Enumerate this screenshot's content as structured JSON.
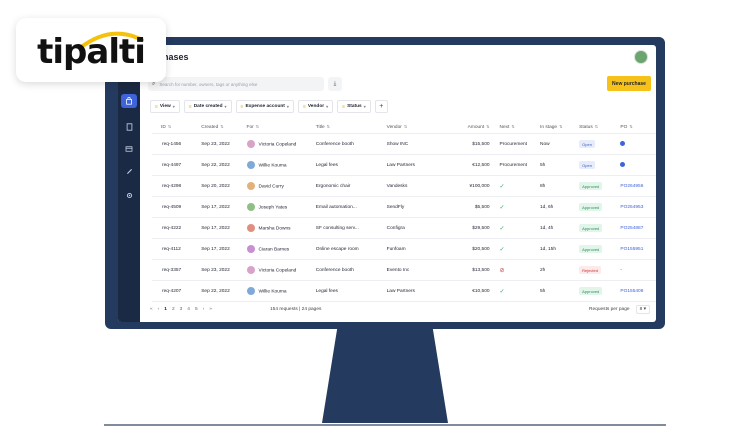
{
  "logo": {
    "text": "tipalti"
  },
  "app": {
    "title": "Purchases",
    "title_visible": "chases",
    "search_placeholder": "Search for number, owners, tags or anything else",
    "new_button": "New purchase",
    "filters": [
      "View",
      "Date created",
      "Expense account",
      "Vendor",
      "Status"
    ],
    "add_filter": "+",
    "columns": [
      "ID",
      "Created",
      "For",
      "Title",
      "Vendor",
      "Amount",
      "Next",
      "In stage",
      "Status",
      "PO"
    ],
    "rows": [
      {
        "id": "req-1456",
        "created": "Sep 23, 2022",
        "for": "Victoria Copeland",
        "title": "Conference booth",
        "vendor": "Show INC",
        "amount": "$15,500",
        "next": "Procurement",
        "stage": "Now",
        "status": "Open",
        "po": ""
      },
      {
        "id": "req-4497",
        "created": "Sep 22, 2022",
        "for": "Willie Kouma",
        "title": "Legal fees",
        "vendor": "Law Partners",
        "amount": "€12,500",
        "next": "Procurement",
        "stage": "5h",
        "status": "Open",
        "po": ""
      },
      {
        "id": "req-4298",
        "created": "Sep 20, 2022",
        "for": "David Curry",
        "title": "Ergonomic chair",
        "vendor": "Vandesks",
        "amount": "¥100,000",
        "next": "✓",
        "stage": "8h",
        "status": "Approved",
        "po": "PO264956"
      },
      {
        "id": "req-4509",
        "created": "Sep 17, 2022",
        "for": "Joseph Yates",
        "title": "Email automation...",
        "vendor": "SendFly",
        "amount": "$5,500",
        "next": "✓",
        "stage": "1d, 6h",
        "status": "Approved",
        "po": "PO254953"
      },
      {
        "id": "req-4222",
        "created": "Sep 17, 2022",
        "for": "Marsha Downs",
        "title": "SF consulting serv...",
        "vendor": "Configra",
        "amount": "$29,500",
        "next": "✓",
        "stage": "1d, 4h",
        "status": "Approved",
        "po": "PO254887"
      },
      {
        "id": "req-4112",
        "created": "Sep 17, 2022",
        "for": "Ciaran Barnes",
        "title": "Online escape room",
        "vendor": "Funfoam",
        "amount": "$20,500",
        "next": "✓",
        "stage": "1d, 15h",
        "status": "Approved",
        "po": "PO155951"
      },
      {
        "id": "req-3357",
        "created": "Sep 23, 2022",
        "for": "Victoria Copeland",
        "title": "Conference booth",
        "vendor": "Evento Inc",
        "amount": "$13,500",
        "next": "⊘",
        "stage": "2h",
        "status": "Rejected",
        "po": "-"
      },
      {
        "id": "req-4207",
        "created": "Sep 22, 2022",
        "for": "Willie Kouma",
        "title": "Legal fees",
        "vendor": "Law Partners",
        "amount": "€10,500",
        "next": "✓",
        "stage": "5h",
        "status": "Approved",
        "po": "PO155408"
      }
    ],
    "pagination": {
      "pages": [
        "1",
        "2",
        "3",
        "4",
        "5"
      ],
      "first": "«",
      "prev": "‹",
      "next": "›",
      "last": "»"
    },
    "summary": "154 requests | 24 pages",
    "rows_per_page_label": "Requests per page",
    "rows_per_page_value": "8"
  },
  "colors": {
    "monitor": "#243a5e",
    "accent": "#3f63d8",
    "new_button": "#f6c21a"
  },
  "icons": [
    "cart-icon",
    "document-icon",
    "card-icon",
    "pen-icon",
    "gear-icon",
    "search-icon",
    "download-icon",
    "filter-icon"
  ]
}
